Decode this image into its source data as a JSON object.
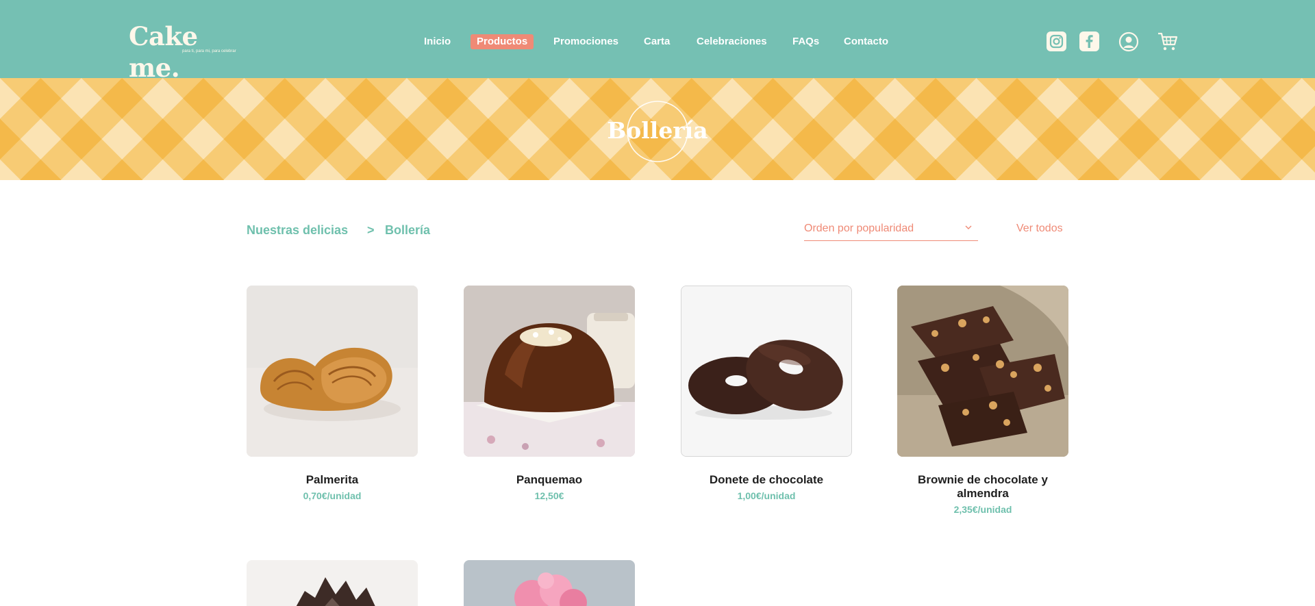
{
  "header": {
    "logo": "Cake me.",
    "tagline": "para ti, para mi, para celebrar",
    "nav": [
      {
        "label": "Inicio",
        "active": false
      },
      {
        "label": "Productos",
        "active": true
      },
      {
        "label": "Promociones",
        "active": false
      },
      {
        "label": "Carta",
        "active": false
      },
      {
        "label": "Celebraciones",
        "active": false
      },
      {
        "label": "FAQs",
        "active": false
      },
      {
        "label": "Contacto",
        "active": false
      }
    ],
    "icons": [
      "instagram-icon",
      "facebook-icon",
      "user-icon",
      "cart-icon"
    ]
  },
  "banner": {
    "title": "Bollería"
  },
  "breadcrumb": {
    "parent": "Nuestras delicias",
    "separator": ">",
    "current": "Bollería"
  },
  "controls": {
    "sort_label": "Orden por popularidad",
    "view_all": "Ver todos"
  },
  "products": [
    {
      "name": "Palmerita",
      "price": "0,70€/unidad"
    },
    {
      "name": "Panquemao",
      "price": "12,50€"
    },
    {
      "name": "Donete de chocolate",
      "price": "1,00€/unidad"
    },
    {
      "name": "Brownie de chocolate y almendra",
      "price": "2,35€/unidad"
    }
  ],
  "colors": {
    "header": "#75c0b3",
    "accent": "#ef8a76",
    "banner": "#f4b94a",
    "teal_text": "#6fc0ad"
  }
}
